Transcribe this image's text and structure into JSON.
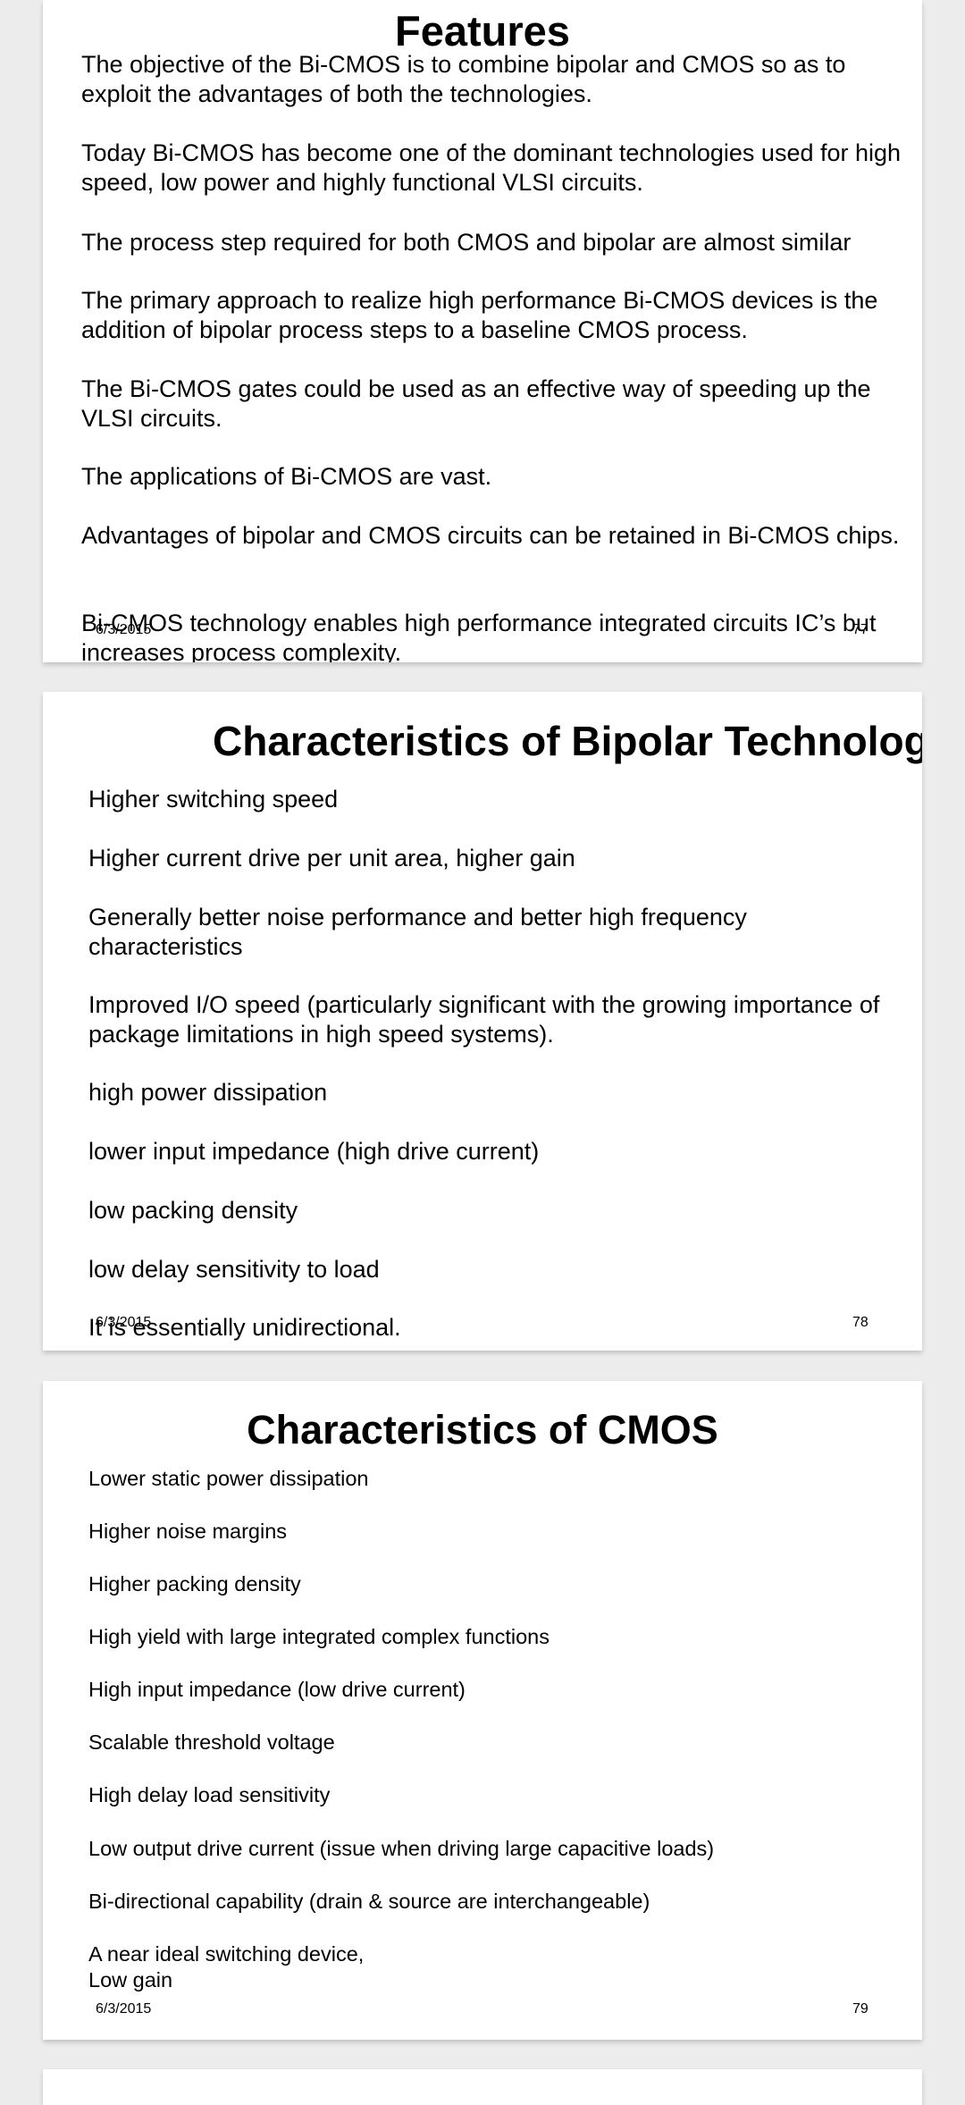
{
  "slides": [
    {
      "title": "Features",
      "items": [
        "The objective of the Bi-CMOS is to combine bipolar and CMOS so as to exploit the advantages of both the technologies.",
        "Today Bi-CMOS has become one of the dominant technologies used for high speed, low power and highly functional VLSI circuits.",
        "The process step required for both CMOS and bipolar are almost similar",
        "The primary approach to realize high performance Bi-CMOS devices is the addition of bipolar process steps to a baseline CMOS process.",
        "The Bi-CMOS gates could be used as an effective way of speeding up the VLSI circuits.",
        "The applications of Bi-CMOS are vast.",
        "Advantages of bipolar and CMOS circuits can be retained in Bi-CMOS chips.",
        "Bi-CMOS technology enables high performance integrated circuits IC’s but increases process complexity."
      ],
      "date": "6/3/2015",
      "page": "77"
    },
    {
      "title": "Characteristics of Bipolar Technology",
      "items": [
        "Higher switching speed",
        "Higher current drive per unit area, higher gain",
        "Generally better noise performance and better high frequency characteristics",
        "Improved I/O speed (particularly significant with the growing importance of package limitations in high speed systems).",
        "high power dissipation",
        "lower input impedance (high drive current)",
        "low packing density",
        "low delay sensitivity to load",
        "It is essentially unidirectional."
      ],
      "date": "6/3/2015",
      "page": "78"
    },
    {
      "title": "Characteristics of CMOS",
      "items": [
        "Lower static power dissipation",
        "Higher noise margins",
        "Higher packing density",
        "High yield with large integrated complex functions",
        "High input impedance (low drive current)",
        "Scalable threshold voltage",
        "High delay load sensitivity",
        "Low output drive current (issue when driving large capacitive loads)",
        "Bi-directional capability (drain & source are interchangeable)",
        "A near ideal switching device,",
        "Low gain"
      ],
      "date": "6/3/2015",
      "page": "79"
    }
  ]
}
